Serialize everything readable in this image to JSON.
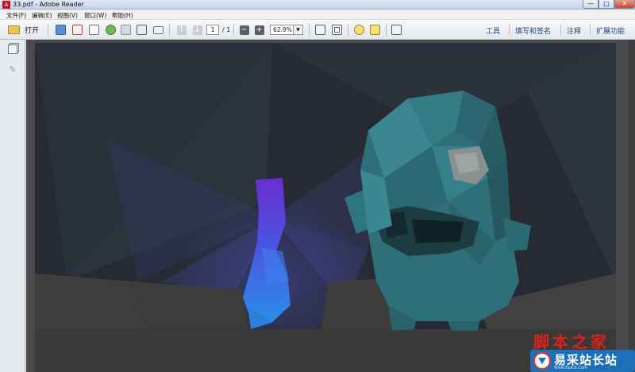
{
  "window": {
    "title": "33.pdf - Adobe Reader",
    "controls": {
      "minimize": "—",
      "maximize": "□",
      "close": "✕"
    }
  },
  "menu": {
    "items": [
      "文件(F)",
      "编辑(E)",
      "视图(V)",
      "窗口(W)",
      "帮助(H)"
    ]
  },
  "toolbar": {
    "open_label": "打开",
    "page_current": "1",
    "page_total": "/ 1",
    "zoom_value": "62.9%",
    "links": [
      "工具",
      "填写和签名",
      "注释",
      "扩展功能"
    ]
  },
  "colors": {
    "page_background": "#262b33",
    "character": "#2f6f78",
    "flame_top": "#6a2fd0",
    "flame_bottom": "#2e8ee8"
  },
  "icons": {
    "open": "folder-icon",
    "side_pages": "pages-panel-icon",
    "side_sign": "pen-icon"
  },
  "watermark": {
    "top_text": "脚本之家",
    "brand": "易采站长站",
    "url": "Www.Easck.Com"
  }
}
